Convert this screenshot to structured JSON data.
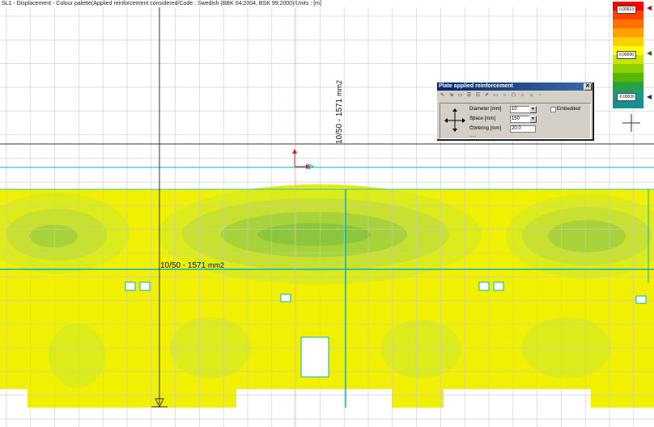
{
  "window": {
    "title": "SL1 - Displacement - Colour palette(Applied reinforcement considered/Code : Swedish (BBK 04:2004, BSK 99:2000)/Units : [m]"
  },
  "legend": {
    "max_label": "0.00913",
    "mid_label": "0.00000",
    "min_label": "-0.00030",
    "colors": [
      "#ff0000",
      "#ff4000",
      "#ff7000",
      "#ffa000",
      "#ffd000",
      "#ffff00",
      "#c8e600",
      "#90d000",
      "#58b800",
      "#2aa040",
      "#1a9a80",
      "#149090"
    ]
  },
  "canvas": {
    "grid_color": "#c8c8c8",
    "plate_colors": {
      "base": "#f0f000",
      "level1": "#dcec1a",
      "level2": "#c8e030",
      "level3": "#a8d23a",
      "level4": "#8cc63c"
    },
    "line_color": "#00b4c8"
  },
  "annotations": {
    "rebar_vertical_main": "10/50 - 1571",
    "rebar_vertical_unit": "mm2",
    "rebar_horizontal_main": "10/50 - 1571",
    "rebar_horizontal_unit": "mm2"
  },
  "dialog": {
    "title": "Plate applied reinforcement",
    "close_label": "✕",
    "diameter_label": "Diameter [mm] .....",
    "diameter_value": "10",
    "space_label": "Space [mm] ........",
    "space_value": "150",
    "covering_label": "Covering [mm] .....",
    "covering_value": "20.0",
    "embedded_label": "Embedded"
  }
}
